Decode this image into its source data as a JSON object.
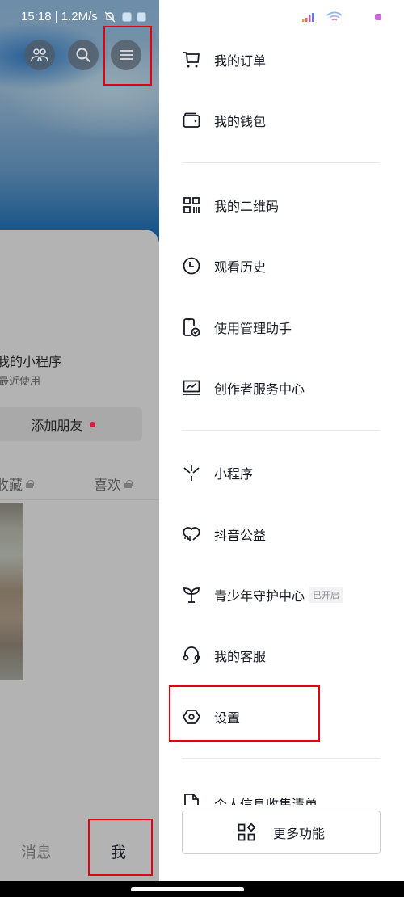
{
  "status_bar": {
    "time_speed": "15:18 | 1.2M/s",
    "signal_icon": "signal-bars-icon",
    "wifi_icon": "wifi-icon",
    "battery_icon": "battery-icon"
  },
  "profile": {
    "top_buttons": [
      "friends-icon",
      "search-icon",
      "menu-icon"
    ],
    "mini_programs_title": "我的小程序",
    "mini_programs_subtitle": "最近使用",
    "add_friend_label": "添加朋友",
    "tabs": [
      {
        "label": "收藏",
        "locked": true
      },
      {
        "label": "喜欢",
        "locked": true
      }
    ],
    "bottom_nav": [
      {
        "label": "消息",
        "active": false
      },
      {
        "label": "我",
        "active": true
      }
    ]
  },
  "drawer": {
    "groups": [
      [
        {
          "label": "我的订单",
          "icon": "cart-icon"
        },
        {
          "label": "我的钱包",
          "icon": "wallet-icon"
        }
      ],
      [
        {
          "label": "我的二维码",
          "icon": "qr-code-icon"
        },
        {
          "label": "观看历史",
          "icon": "clock-icon"
        },
        {
          "label": "使用管理助手",
          "icon": "phone-check-icon"
        },
        {
          "label": "创作者服务中心",
          "icon": "chart-monitor-icon"
        }
      ],
      [
        {
          "label": "小程序",
          "icon": "mini-program-icon"
        },
        {
          "label": "抖音公益",
          "icon": "charity-heart-icon"
        },
        {
          "label": "青少年守护中心",
          "icon": "sprout-icon",
          "badge": "已开启"
        },
        {
          "label": "我的客服",
          "icon": "headset-icon"
        },
        {
          "label": "设置",
          "icon": "settings-hexagon-icon"
        }
      ],
      [
        {
          "label": "个人信息收集清单",
          "icon": "document-icon"
        }
      ]
    ],
    "more_button_label": "更多功能"
  },
  "colors": {
    "highlight": "#e3000f",
    "notification_dot": "#d21a3f",
    "text_primary": "#161823"
  }
}
